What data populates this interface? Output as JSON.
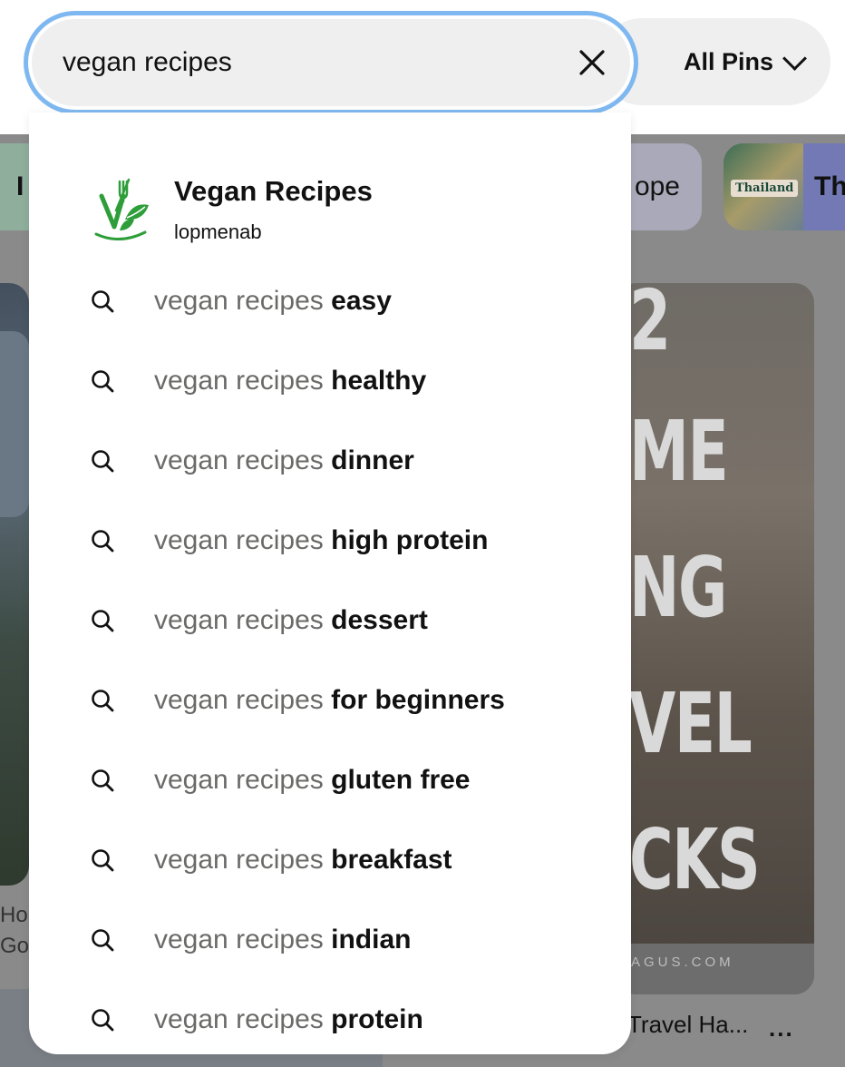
{
  "search": {
    "value": "vegan recipes",
    "clear_icon": "close-icon"
  },
  "filter": {
    "label": "All Pins",
    "icon": "chevron-down-icon"
  },
  "board_result": {
    "title": "Vegan Recipes",
    "owner": "lopmenab",
    "logo_icon": "vegan-fork-leaf-logo"
  },
  "suggestions": [
    {
      "base": "vegan recipes",
      "completion": "easy"
    },
    {
      "base": "vegan recipes",
      "completion": "healthy"
    },
    {
      "base": "vegan recipes",
      "completion": "dinner"
    },
    {
      "base": "vegan recipes",
      "completion": "high protein"
    },
    {
      "base": "vegan recipes",
      "completion": "dessert"
    },
    {
      "base": "vegan recipes",
      "completion": "for beginners"
    },
    {
      "base": "vegan recipes",
      "completion": "gluten free"
    },
    {
      "base": "vegan recipes",
      "completion": "breakfast"
    },
    {
      "base": "vegan recipes",
      "completion": "indian"
    },
    {
      "base": "vegan recipes",
      "completion": "protein"
    }
  ],
  "background": {
    "chip_left_text": "I",
    "chip_mid_text": "ope",
    "chip_thumb_tag": "Thailand",
    "chip_right_text": "Th",
    "pin_left_caption_line1": "Ho",
    "pin_left_caption_line2": "Go",
    "pin_right_lines": [
      "2",
      "ME",
      "NG",
      "VEL",
      "CKS"
    ],
    "pin_right_site": "AGUS.COM",
    "pin_right_caption": "Travel Ha...",
    "pin_right_more": "..."
  },
  "colors": {
    "focus_ring": "#7fb8f0",
    "search_bg": "#efefef",
    "suggestion_base": "#6a6a68",
    "logo_green": "#2e9e3a"
  }
}
